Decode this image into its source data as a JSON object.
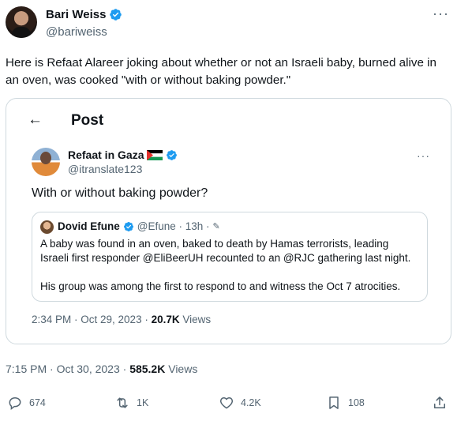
{
  "author": {
    "name": "Bari Weiss",
    "handle": "@bariweiss"
  },
  "tweet": {
    "text": "Here is Refaat Alareer joking about whether or not an Israeli baby, burned alive in an oven, was cooked \"with or without baking powder.\"",
    "time": "7:15 PM · Oct 30, 2023 · ",
    "views_count": "585.2K",
    "views_label": " Views"
  },
  "quoted": {
    "header_title": "Post",
    "author_name": "Refaat in Gaza",
    "author_handle": "@itranslate123",
    "text": "With or without baking powder?",
    "time": "2:34 PM · Oct 29, 2023 · ",
    "views_count": "20.7K",
    "views_label": " Views",
    "nested": {
      "author_name": "Dovid Efune",
      "meta": "@Efune · 13h ·",
      "paragraph1": "A baby was found in an oven, baked to death by Hamas terrorists, leading Israeli first responder @EliBeerUH recounted to an @RJC gathering last night.",
      "paragraph2": "His group was among the first to respond to and witness the Oct 7 atrocities."
    }
  },
  "actions": {
    "replies": "674",
    "retweets": "1K",
    "likes": "4.2K",
    "bookmarks": "108"
  },
  "colors": {
    "verified": "#1d9bf0",
    "secondary_text": "#536471",
    "border": "#cfd9de"
  },
  "icons": [
    "verified-badge-icon",
    "more-icon",
    "back-arrow-icon",
    "palestine-flag-icon",
    "pencil-icon",
    "reply-icon",
    "retweet-icon",
    "like-icon",
    "bookmark-icon",
    "share-icon"
  ]
}
